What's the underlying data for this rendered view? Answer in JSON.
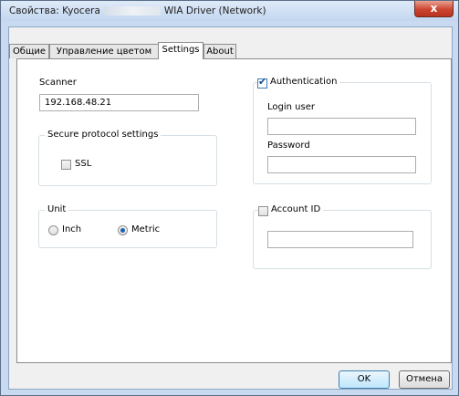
{
  "window": {
    "title_prefix": "Свойства: Kyocera",
    "title_suffix": "WIA Driver (Network)",
    "close_glyph": "x"
  },
  "tabs": [
    {
      "label": "Общие"
    },
    {
      "label": "Управление цветом"
    },
    {
      "label": "Settings"
    },
    {
      "label": "About"
    }
  ],
  "active_tab": "Settings",
  "scanner": {
    "label": "Scanner",
    "address": "192.168.48.21"
  },
  "secure_protocol": {
    "legend": "Secure protocol settings",
    "ssl_label": "SSL",
    "ssl_checked": false
  },
  "unit": {
    "legend": "Unit",
    "options": [
      "Inch",
      "Metric"
    ],
    "selected": "Metric"
  },
  "authentication": {
    "label": "Authentication",
    "checked": true,
    "login_user_label": "Login user",
    "login_user_value": "",
    "password_label": "Password",
    "password_value": ""
  },
  "account_id": {
    "label": "Account ID",
    "checked": false,
    "value": ""
  },
  "buttons": {
    "ok": "OK",
    "cancel": "Отмена"
  },
  "colors": {
    "title_bar": "#c9daf0",
    "close_button": "#cc4531",
    "radio_selected": "#1f5fb6"
  }
}
